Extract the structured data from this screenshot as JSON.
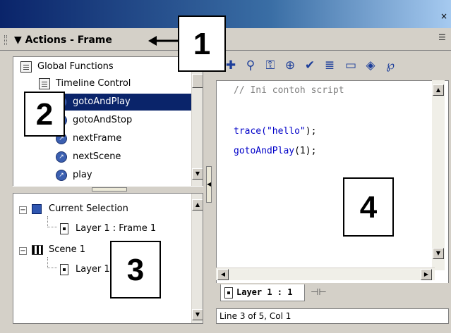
{
  "panel": {
    "title": "Actions - Frame",
    "collapse_glyph": "▼"
  },
  "callouts": [
    "1",
    "2",
    "3",
    "4"
  ],
  "toolbox": {
    "items": [
      {
        "label": "Global Functions",
        "icon": "book-icon"
      },
      {
        "label": "Timeline Control",
        "icon": "book-icon"
      },
      {
        "label": "gotoAndPlay",
        "icon": "function-icon",
        "selected": true
      },
      {
        "label": "gotoAndStop",
        "icon": "function-icon"
      },
      {
        "label": "nextFrame",
        "icon": "function-icon"
      },
      {
        "label": "nextScene",
        "icon": "function-icon"
      },
      {
        "label": "play",
        "icon": "function-icon"
      }
    ]
  },
  "script_navigator": {
    "items": [
      {
        "label": "Current Selection",
        "icon": "selection-icon",
        "expander": "−"
      },
      {
        "label": "Layer 1 : Frame 1",
        "icon": "layer-icon"
      },
      {
        "label": "Scene 1",
        "icon": "scene-icon",
        "expander": "−"
      },
      {
        "label": "Layer 1 : Frame 1",
        "icon": "layer-icon"
      }
    ]
  },
  "toolbar": {
    "tools": [
      {
        "name": "add-item-icon",
        "glyph": "✚"
      },
      {
        "name": "find-icon",
        "glyph": "⚲"
      },
      {
        "name": "replace-icon",
        "glyph": "⚿"
      },
      {
        "name": "target-path-icon",
        "glyph": "⊕"
      },
      {
        "name": "check-syntax-icon",
        "glyph": "✔"
      },
      {
        "name": "auto-format-icon",
        "glyph": "≣"
      },
      {
        "name": "code-hint-icon",
        "glyph": "▭"
      },
      {
        "name": "debug-options-icon",
        "glyph": "◈"
      },
      {
        "name": "script-assist-icon",
        "glyph": "℘"
      }
    ]
  },
  "editor": {
    "lines": {
      "comment": "// Ini contoh script",
      "trace_fn": "trace(",
      "trace_arg": "\"hello\"",
      "trace_end": ");",
      "goto_fn": "gotoAndPlay",
      "goto_rest": "(1);"
    }
  },
  "tab": {
    "label": "Layer 1 : 1"
  },
  "status": {
    "text": "Line 3 of 5, Col 1"
  },
  "colors": {
    "title_blue": "#0a246a",
    "selection": "#0a246a",
    "code_blue": "#0000c8",
    "comment_gray": "#808080"
  }
}
